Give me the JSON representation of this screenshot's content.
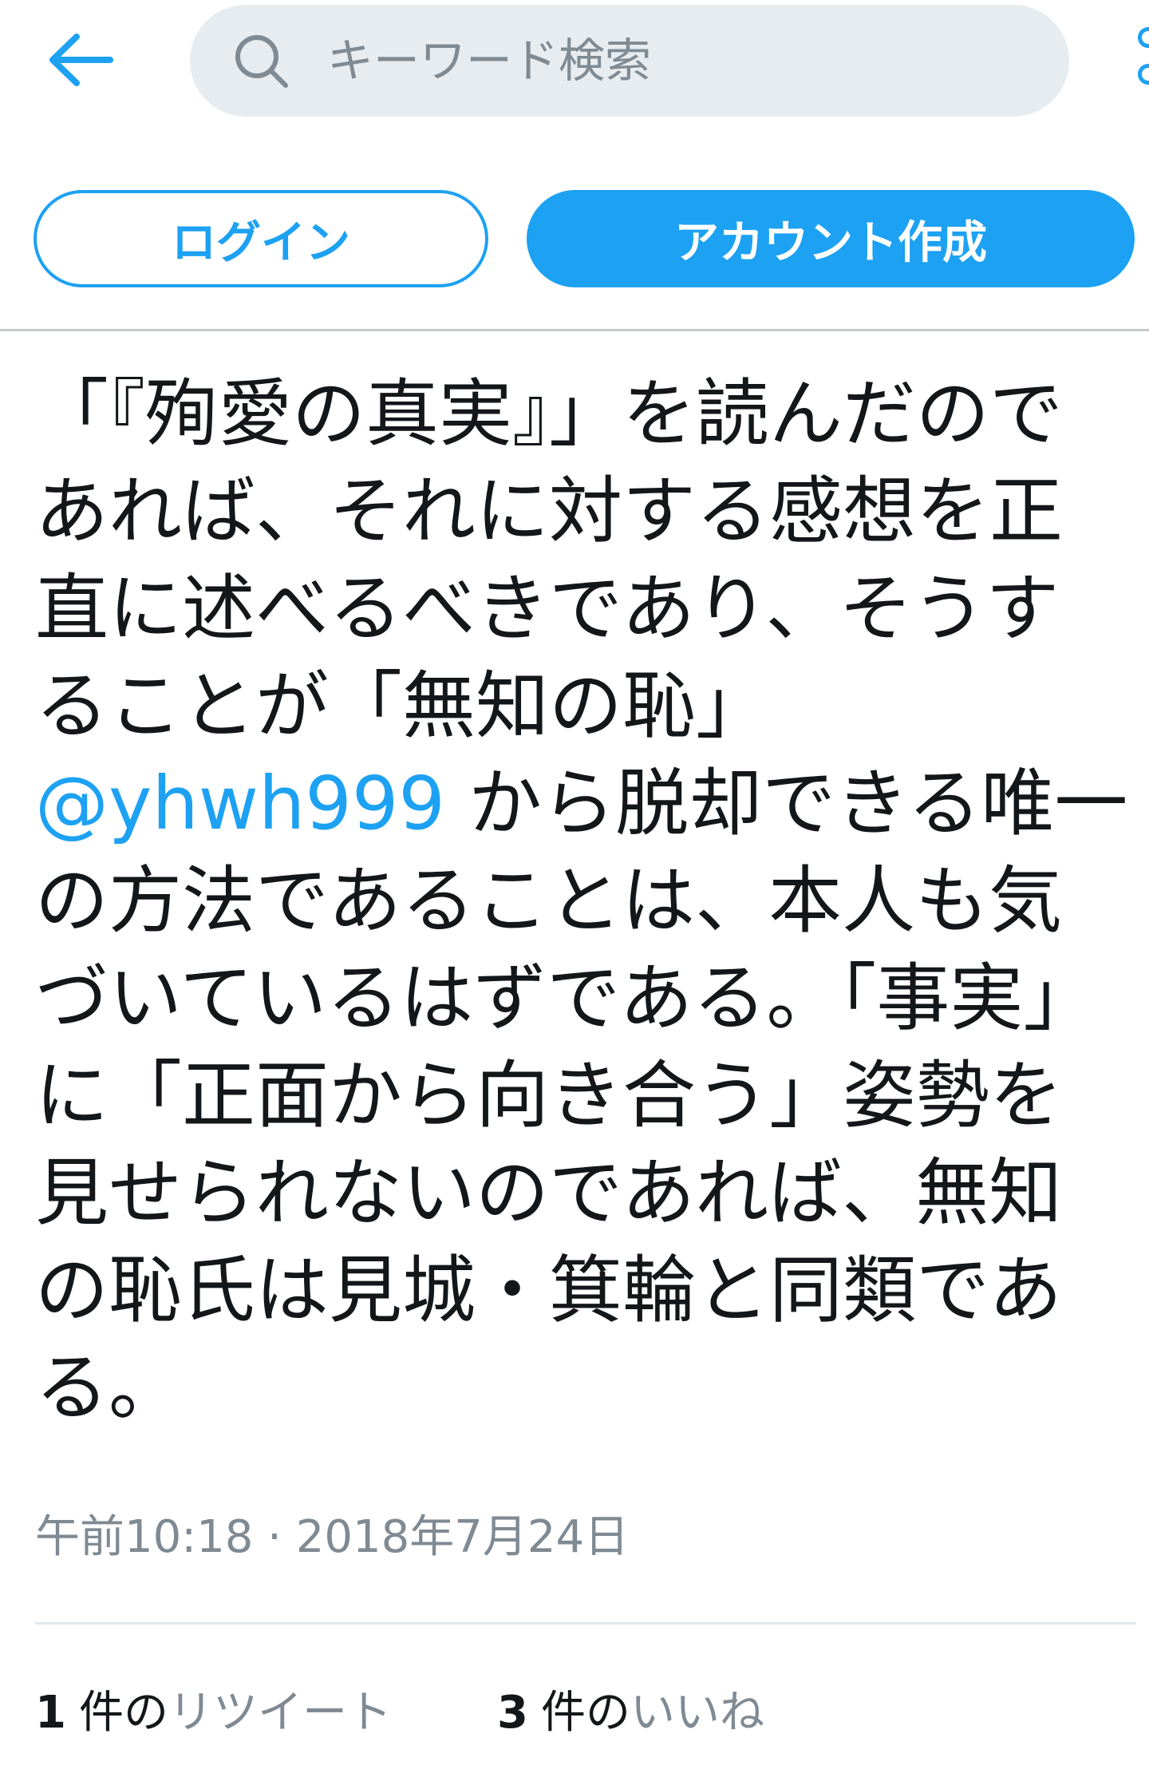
{
  "header": {
    "search_placeholder": "キーワード検索"
  },
  "auth": {
    "login_label": "ログイン",
    "signup_label": "アカウント作成"
  },
  "tweet": {
    "text_before": "「『殉愛の真実』」を読んだのであれば、それに対する感想を正直に述べるべきであり、そうすることが「無知の恥」",
    "mention": "@yhwh999",
    "text_after": "から脱却できる唯一の方法であることは、本人も気づいているはずである。「事実」に「正面から向き合う」姿勢を見せられないのであれば、無知の恥氏は見城・箕輪と同類である。",
    "timestamp": "午前10:18 · 2018年7月24日"
  },
  "stats": {
    "retweets": {
      "count": "1",
      "unit": "件の",
      "label": "リツイート"
    },
    "likes": {
      "count": "3",
      "unit": "件の",
      "label": "いいね"
    }
  },
  "colors": {
    "accent": "#1da1f2",
    "muted_text": "#7f8a93",
    "search_bg": "#e6ecf0",
    "text": "#14171a"
  },
  "icons": {
    "back": "arrow-left-icon",
    "search": "search-icon",
    "more": "more-vertical-icon"
  }
}
